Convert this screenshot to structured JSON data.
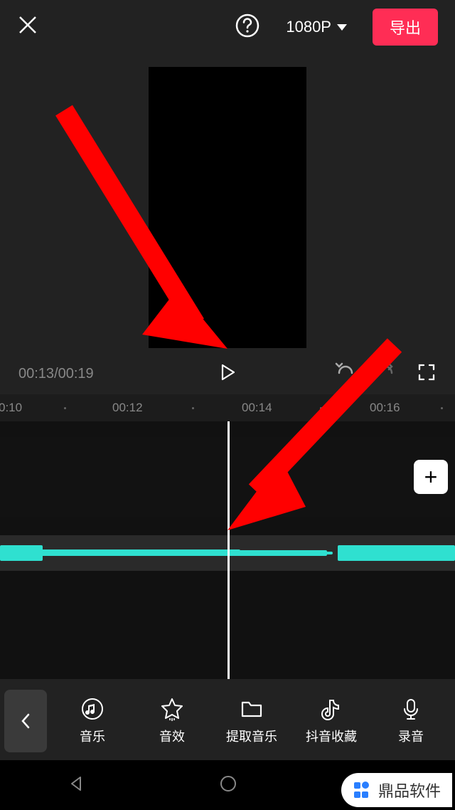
{
  "header": {
    "resolution_label": "1080P",
    "export_label": "导出"
  },
  "playbar": {
    "current_time": "00:13",
    "total_time": "00:19"
  },
  "ruler": {
    "ticks": [
      "0:10",
      "00:12",
      "00:14",
      "00:16"
    ]
  },
  "tools": {
    "music": "音乐",
    "sfx": "音效",
    "extract": "提取音乐",
    "douyin_fav": "抖音收藏",
    "record": "录音"
  },
  "watermark": {
    "text": "鼎品软件"
  },
  "icons": {
    "add": "+"
  }
}
